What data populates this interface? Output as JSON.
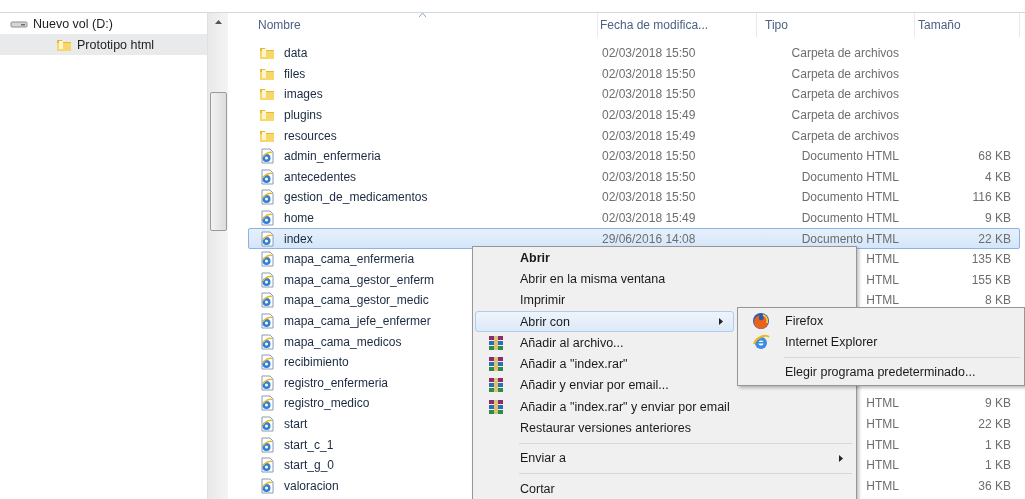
{
  "navigation": {
    "items": [
      {
        "label": "Nuevo vol (D:)",
        "kind": "drive",
        "selected": false,
        "children": [
          {
            "label": "Prototipo html",
            "kind": "folder",
            "selected": true
          }
        ]
      }
    ]
  },
  "file_list": {
    "columns": [
      {
        "label": "Nombre",
        "sorted": true
      },
      {
        "label": "Fecha de modifica...",
        "sorted": false
      },
      {
        "label": "Tipo",
        "sorted": false
      },
      {
        "label": "Tamaño",
        "sorted": false
      }
    ],
    "rows": [
      {
        "name": "data",
        "kind": "folder",
        "modified": "02/03/2018 15:50",
        "type": "Carpeta de archivos",
        "selected": false
      },
      {
        "name": "files",
        "kind": "folder",
        "modified": "02/03/2018 15:50",
        "type": "Carpeta de archivos",
        "selected": false
      },
      {
        "name": "images",
        "kind": "folder",
        "modified": "02/03/2018 15:50",
        "type": "Carpeta de archivos",
        "selected": false
      },
      {
        "name": "plugins",
        "kind": "folder",
        "modified": "02/03/2018 15:49",
        "type": "Carpeta de archivos",
        "selected": false
      },
      {
        "name": "resources",
        "kind": "folder",
        "modified": "02/03/2018 15:49",
        "type": "Carpeta de archivos",
        "selected": false
      },
      {
        "name": "admin_enfermeria",
        "kind": "html",
        "modified": "02/03/2018 15:50",
        "type": "Documento HTML",
        "size": "68 KB",
        "selected": false
      },
      {
        "name": "antecedentes",
        "kind": "html",
        "modified": "02/03/2018 15:50",
        "type": "Documento HTML",
        "size": "4 KB",
        "selected": false
      },
      {
        "name": "gestion_de_medicamentos",
        "kind": "html",
        "modified": "02/03/2018 15:50",
        "type": "Documento HTML",
        "size": "116 KB",
        "selected": false
      },
      {
        "name": "home",
        "kind": "html",
        "modified": "02/03/2018 15:49",
        "type": "Documento HTML",
        "size": "9 KB",
        "selected": false
      },
      {
        "name": "index",
        "kind": "html",
        "modified": "29/06/2016 14:08",
        "type": "Documento HTML",
        "size": "22 KB",
        "selected": true
      },
      {
        "name": "mapa_cama_enfermeria",
        "kind": "html",
        "type": "HTML",
        "size": "135 KB",
        "selected": false
      },
      {
        "name": "mapa_cama_gestor_enferm",
        "kind": "html",
        "type": "HTML",
        "size": "155 KB",
        "selected": false
      },
      {
        "name": "mapa_cama_gestor_medic",
        "kind": "html",
        "type": "HTML",
        "size": "8 KB",
        "selected": false
      },
      {
        "name": "mapa_cama_jefe_enfermer",
        "kind": "html",
        "selected": false
      },
      {
        "name": "mapa_cama_medicos",
        "kind": "html",
        "selected": false
      },
      {
        "name": "recibimiento",
        "kind": "html",
        "selected": false
      },
      {
        "name": "registro_enfermeria",
        "kind": "html",
        "selected": false
      },
      {
        "name": "registro_medico",
        "kind": "html",
        "type": "HTML",
        "size": "9 KB",
        "selected": false
      },
      {
        "name": "start",
        "kind": "html",
        "type": "HTML",
        "size": "22 KB",
        "selected": false
      },
      {
        "name": "start_c_1",
        "kind": "html",
        "type": "HTML",
        "size": "1 KB",
        "selected": false
      },
      {
        "name": "start_g_0",
        "kind": "html",
        "type": "HTML",
        "size": "1 KB",
        "selected": false
      },
      {
        "name": "valoracion",
        "kind": "html",
        "type": "HTML",
        "size": "36 KB",
        "selected": false
      }
    ]
  },
  "context_menu": {
    "items": [
      {
        "kind": "plain",
        "label": "Abrir",
        "default": true,
        "selected": false
      },
      {
        "kind": "plain",
        "label": "Abrir en la misma ventana",
        "selected": false
      },
      {
        "kind": "plain",
        "label": "Imprimir",
        "selected": false
      },
      {
        "kind": "plain",
        "label": "Abrir con",
        "has_submenu": true,
        "selected": true
      },
      {
        "kind": "archive",
        "label": "Añadir al archivo...",
        "selected": false
      },
      {
        "kind": "archive",
        "label": "Añadir a \"index.rar\"",
        "selected": false
      },
      {
        "kind": "archive",
        "label": "Añadir y enviar por email...",
        "selected": false
      },
      {
        "kind": "archive",
        "label": "Añadir a \"index.rar\" y enviar por email",
        "selected": false
      },
      {
        "kind": "plain",
        "label": "Restaurar versiones anteriores",
        "selected": false
      },
      {
        "kind": "separator"
      },
      {
        "kind": "plain",
        "label": "Enviar a",
        "has_submenu": true,
        "selected": false
      },
      {
        "kind": "separator"
      },
      {
        "kind": "plain",
        "label": "Cortar",
        "selected": false
      }
    ]
  },
  "submenu": {
    "items": [
      {
        "kind": "firefox",
        "label": "Firefox"
      },
      {
        "kind": "explorer",
        "label": "Internet Explorer"
      },
      {
        "kind": "separator"
      },
      {
        "kind": "plain",
        "label": "Elegir programa predeterminado..."
      }
    ]
  }
}
